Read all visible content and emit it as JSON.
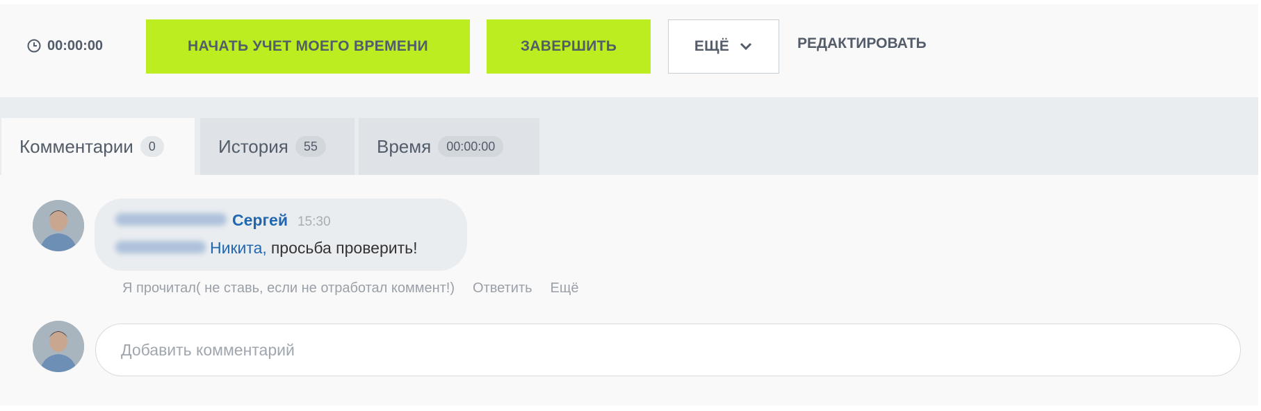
{
  "toolbar": {
    "timer_icon": "clock-icon",
    "timer_value": "00:00:00",
    "start_label": "НАЧАТЬ УЧЕТ МОЕГО ВРЕМЕНИ",
    "finish_label": "ЗАВЕРШИТЬ",
    "more_label": "ЕЩЁ",
    "more_icon": "chevron-down-icon",
    "edit_label": "РЕДАКТИРОВАТЬ",
    "accent_color": "#bbed21"
  },
  "tabs": [
    {
      "label": "Комментарии",
      "count": "0",
      "active": true
    },
    {
      "label": "История",
      "count": "55",
      "active": false
    },
    {
      "label": "Время",
      "count": "00:00:00",
      "active": false
    }
  ],
  "comment": {
    "author_first_name": "Сергей",
    "time": "15:30",
    "mention": "Никита,",
    "text": "просьба проверить!",
    "actions": {
      "read": "Я прочитал( не ставь, если не отработал коммент!)",
      "reply": "Ответить",
      "more": "Ещё"
    }
  },
  "new_comment": {
    "placeholder": "Добавить комментарий"
  }
}
